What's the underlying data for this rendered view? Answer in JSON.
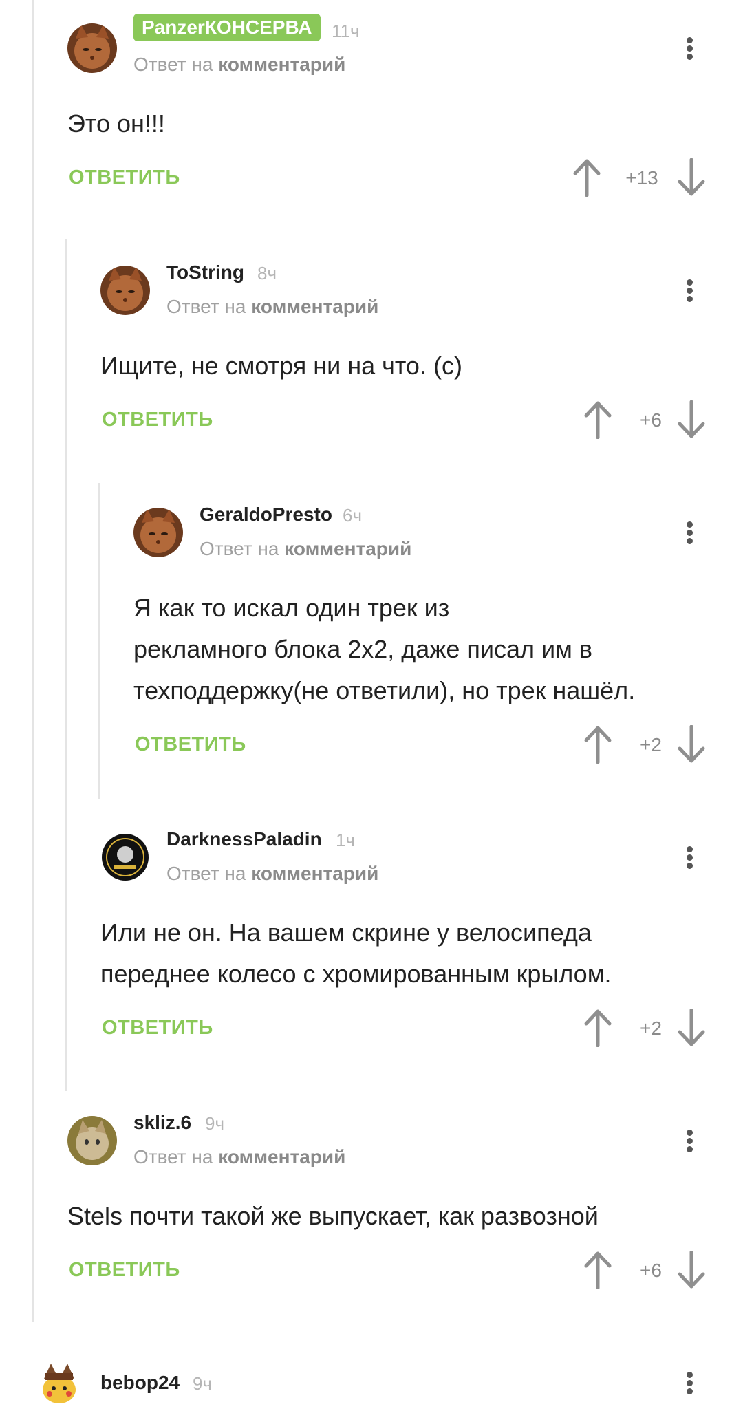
{
  "reply_to_prefix": "Ответ на",
  "reply_to_link": "комментарий",
  "reply_button_label": "ОТВЕТИТЬ",
  "colors": {
    "accent": "#8ac858",
    "thread_line": "#e4e4e4",
    "muted": "#a0a0a0"
  },
  "comments": [
    {
      "author": "PanzerКОНСЕРВА",
      "time": "11ч",
      "lines": [
        "Это он!!!"
      ],
      "score": "+13",
      "author_highlighted": true
    },
    {
      "author": "ToString",
      "time": "8ч",
      "lines": [
        "Ищите, не смотря ни на что. (с)"
      ],
      "score": "+6"
    },
    {
      "author": "GeraldoPresto",
      "time": "6ч",
      "lines": [
        "Я как то искал один трек из",
        "рекламного блока 2х2, даже писал им в",
        "техподдержку(не ответили), но трек нашёл."
      ],
      "score": "+2"
    },
    {
      "author": "DarknessPaladin",
      "time": "1ч",
      "lines": [
        "Или не он. На вашем скрине у велосипеда",
        "переднее колесо с хромированным крылом."
      ],
      "score": "+2"
    },
    {
      "author": "skliz.6",
      "time": "9ч",
      "lines": [
        "Stels почти такой же выпускает, как развозной"
      ],
      "score": "+6"
    },
    {
      "author": "bebop24",
      "time": "9ч"
    }
  ]
}
